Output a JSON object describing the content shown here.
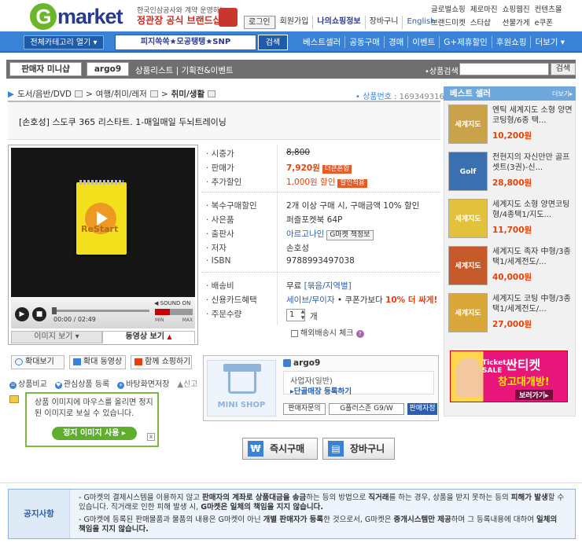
{
  "header": {
    "logo": "market",
    "logo_g": "G",
    "official_l1": "한국인삼공사와 계약 운영하는",
    "official_l2": "정관장 공식 브랜드샵",
    "seal": "正官庄",
    "nav": [
      "로그인",
      "회원가입",
      "나의쇼핑정보",
      "장바구니",
      "English"
    ],
    "toplinks": [
      "글로벌쇼핑",
      "제로마진",
      "쇼핑웹진",
      "컨텐츠몰",
      "브랜드미켓",
      "스타샵",
      "선물가게",
      "e쿠폰"
    ]
  },
  "bluebar": {
    "category_btn": "전체카테고리 열기 ▾",
    "search_value": "피지쏙쏙★모공탱탱★SNP",
    "search_btn": "검색",
    "menu": [
      "베스트셀러",
      "공동구매",
      "경매",
      "이벤트",
      "G+제휴할인",
      "후원쇼핑",
      "더보기 ▾"
    ]
  },
  "minishop": {
    "label": "판매자 미니샵",
    "seller": "argo9",
    "links": "상품리스트 | 기획전&이벤트",
    "search_label": "•상품검색",
    "search_btn": "검색"
  },
  "breadcrumb": [
    "도서/음반/DVD",
    "여행/취미/레저",
    "취미/생활"
  ],
  "product_no_label": "• 상품번호 :",
  "product_no": "169349316",
  "title": "[손호성] 스도쿠 365 리스타트. 1-매일매일 두뇌트레이닝",
  "video": {
    "overlay": "ReStart",
    "time": "00:00 / 02:49",
    "sound": "SOUND ON",
    "min": "MIN",
    "max": "MAX",
    "tab_image": "이미지 보기 ▾",
    "tab_video": "동영상 보기"
  },
  "actions": [
    "확대보기",
    "확대 동영상",
    "함께 쇼핑하기"
  ],
  "links2": [
    "상품비교",
    "관심상품 등록",
    "바탕화면저장",
    "신고"
  ],
  "tip": {
    "text": "상품 이미지에 마우스를 올리면 정지된 이미지로 보실 수 있습니다.",
    "button": "정지 이미지 사용 ▸",
    "close": "x"
  },
  "info": {
    "list_label": "· 시중가",
    "list_price": "8,800",
    "sale_label": "· 판매가",
    "sale_price": "7,920원",
    "sale_badge": "더큰혼합",
    "disc_label": "· 추가할인",
    "disc_value": "1,000원 할인",
    "disc_badge": "할인적용",
    "multi_label": "· 복수구매할인",
    "multi_value": "2개 이상 구매 시, 구매금액 10% 할인",
    "gift_label": "· 사은품",
    "gift_value": "퍼즐포켓북 64P",
    "pub_label": "· 출판사",
    "pub_value": "아르고나인",
    "pub_btn": "G마켓 책정보",
    "author_label": "· 저자",
    "author_value": "손호성",
    "isbn_label": "· ISBN",
    "isbn_value": "9788993497038",
    "ship_label": "· 배송비",
    "ship_value": "무료",
    "ship_link": "[묶음/지역별]",
    "card_label": "· 신용카드혜택",
    "card_value": "세이브/무이자",
    "card_extra": "• 쿠폰가보다",
    "card_red": "10% 더 싸게!",
    "qty_label": "· 주문수량",
    "qty_value": "1",
    "qty_unit": "개",
    "overseas": "해외배송시 체크"
  },
  "seller": {
    "logo_text": "MINI SHOP",
    "name": "argo9",
    "type": "사업자(일반)",
    "regular": "▸단골매장 등록하기",
    "btn1": "판매자문의",
    "btn2": "G플러스존 G9/W",
    "btn3": "판매자정보"
  },
  "buy": {
    "buy": "즉시구매",
    "cart": "장바구니",
    "won": "₩"
  },
  "bestseller": {
    "title": "베스트 셀러",
    "more": "더보기▸",
    "items": [
      {
        "thumb": "세계지도",
        "name": "엔틱 세계지도 소형 양면 코팅형/6종 택...",
        "price": "10,200원"
      },
      {
        "thumb": "Golf",
        "name": "전현지의 자신만만 골프 셋트(3권)-신...",
        "price": "28,800원"
      },
      {
        "thumb": "세계지도",
        "name": "세계지도 소형 양면코팅형/4종택1/지도...",
        "price": "11,700원"
      },
      {
        "thumb": "세계지도",
        "name": "세계지도 족자 中형/3종 택1/세계전도/...",
        "price": "40,000원"
      },
      {
        "thumb": "세계지도",
        "name": "세계지도 코팅 中형/3종 택1/세계전도/...",
        "price": "27,000원"
      }
    ],
    "colors": [
      "#c9a24a",
      "#3b6fb0",
      "#e2c23c",
      "#c45a2a",
      "#d9a73a"
    ]
  },
  "banner": {
    "ticket": "Ticket",
    "sale": "SALE",
    "t2": "싼티켓",
    "t3": "창고대개방!",
    "t4": "보러가기▸"
  },
  "notice": {
    "label": "공지사항",
    "l1_a": "- G마켓의 결제시스템을 이용하지 않고 ",
    "l1_b": "판매자의 계좌로 상품대금을 송금",
    "l1_c": "하는 등의 방법으로 ",
    "l1_d": "직거래",
    "l1_e": "를 하는 경우, 상품을 받지 못하는 등의 ",
    "l1_f": "피해가 발생",
    "l1_g": "할 수 있습니다. 직거래로 인한 피해 발생 시, ",
    "l1_h": "G마켓은 일체의 책임을 지지 않습니다.",
    "l2_a": "- G마켓에 등록된 판매물품과 물품의 내용은 G마켓이 아닌 ",
    "l2_b": "개별 판매자가 등록",
    "l2_c": "한 것으로서, G마켓은 ",
    "l2_d": "중개시스템만 제공",
    "l2_e": "하며 그 등록내용에 대하여 ",
    "l2_f": "일체의 책임을 지지 않습니다."
  }
}
